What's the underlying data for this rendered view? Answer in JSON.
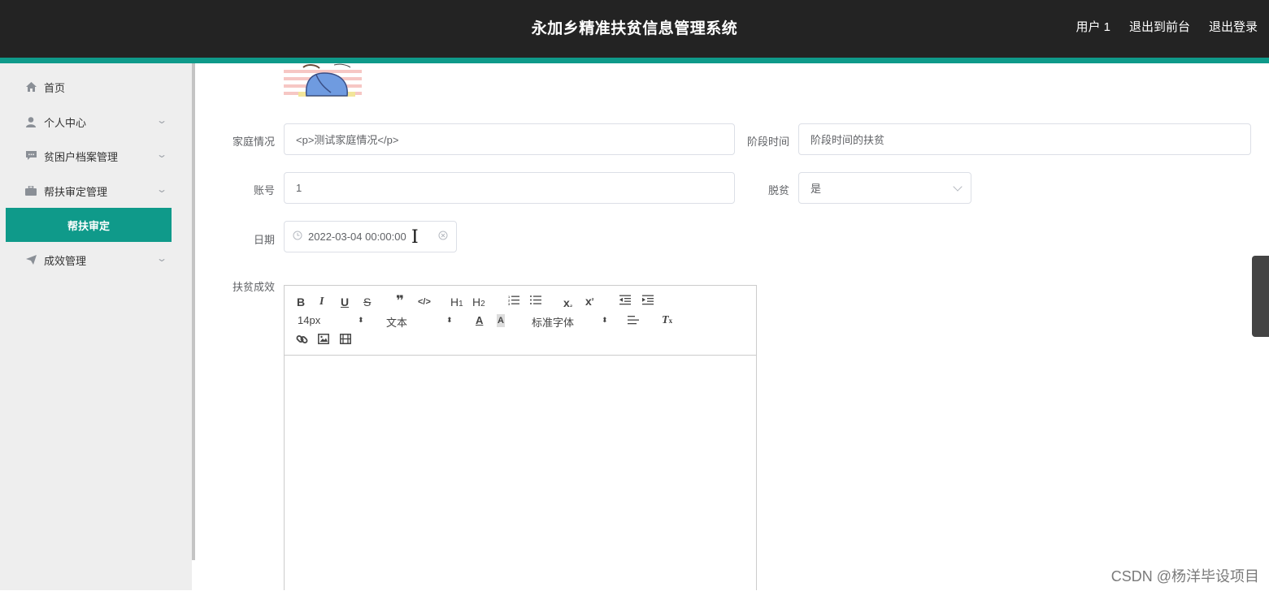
{
  "header": {
    "title": "永加乡精准扶贫信息管理系统",
    "user_label": "用户 1",
    "back_to_front": "退出到前台",
    "logout": "退出登录"
  },
  "sidebar": {
    "items": [
      {
        "label": "首页",
        "icon": "home-icon",
        "expandable": false
      },
      {
        "label": "个人中心",
        "icon": "user-icon",
        "expandable": true
      },
      {
        "label": "贫困户档案管理",
        "icon": "chat-icon",
        "expandable": true
      },
      {
        "label": "帮扶审定管理",
        "icon": "briefcase-icon",
        "expandable": true
      },
      {
        "label": "成效管理",
        "icon": "send-icon",
        "expandable": true
      }
    ],
    "active_sub_item": "帮扶审定"
  },
  "form": {
    "family_label": "家庭情况",
    "family_value": "<p>测试家庭情况</p>",
    "stage_label": "阶段时间",
    "stage_placeholder": "阶段时间的扶贫",
    "account_label": "账号",
    "account_value": "1",
    "poverty_label": "脱贫",
    "poverty_value": "是",
    "date_label": "日期",
    "date_value": "2022-03-04 00:00:00",
    "result_label": "扶贫成效"
  },
  "editor": {
    "font_size": "14px",
    "text_style": "文本",
    "font_family": "标准字体"
  },
  "colors": {
    "header_bg": "#232323",
    "accent": "#0f9a8a",
    "sidebar_bg": "#eeeeee"
  },
  "watermark": "CSDN @杨洋毕设项目"
}
